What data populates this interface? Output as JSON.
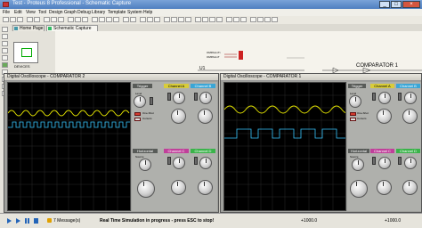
{
  "window": {
    "title": "Test - Proteus 8 Professional - Schematic Capture",
    "min": "_",
    "max": "□",
    "close": "×"
  },
  "menu": [
    "File",
    "Edit",
    "View",
    "Tool",
    "Design",
    "Graph",
    "Debug",
    "Library",
    "Template",
    "System",
    "Help"
  ],
  "tabs": [
    {
      "label": "Home Page"
    },
    {
      "label": "Schematic Capture"
    }
  ],
  "schematic": {
    "u1_label": "U1",
    "comparator_label": "COMPARATOR 1",
    "netlabels": [
      "OMPA1mTt",
      "OMPA1mT"
    ],
    "panel_label": "DEVICES"
  },
  "osc_left": {
    "title": "Digital Oscilloscope - COMPARATOR 2",
    "trigger": "Trigger",
    "level": "Level",
    "position": "Position",
    "one_shot": "One-Shot",
    "cursors": "Cursors",
    "horizontal": "Horizontal",
    "source": "Source",
    "channel_a": "Channel A",
    "channel_b": "Channel B",
    "channel_c": "Channel C",
    "channel_d": "Channel D",
    "colors": {
      "trace1": "#e6e600",
      "trace2": "#39c6ff",
      "grid": "#2b2b2b",
      "label_bg": "#585b58"
    }
  },
  "osc_right": {
    "title": "Digital Oscilloscope - COMPARATOR 1",
    "trigger": "Trigger",
    "level": "Level",
    "position": "Position",
    "one_shot": "One-Shot",
    "cursors": "Cursors",
    "horizontal": "Horizontal",
    "source": "Source",
    "channel_a": "Channel A",
    "channel_b": "Channel B",
    "channel_c": "Channel C",
    "channel_d": "Channel D"
  },
  "status": {
    "messages": "7 Message(s)",
    "sim_status": "Real Time Simulation in progress - press ESC to stop!",
    "time": "+1000.0",
    "time2": "+1000.0"
  }
}
